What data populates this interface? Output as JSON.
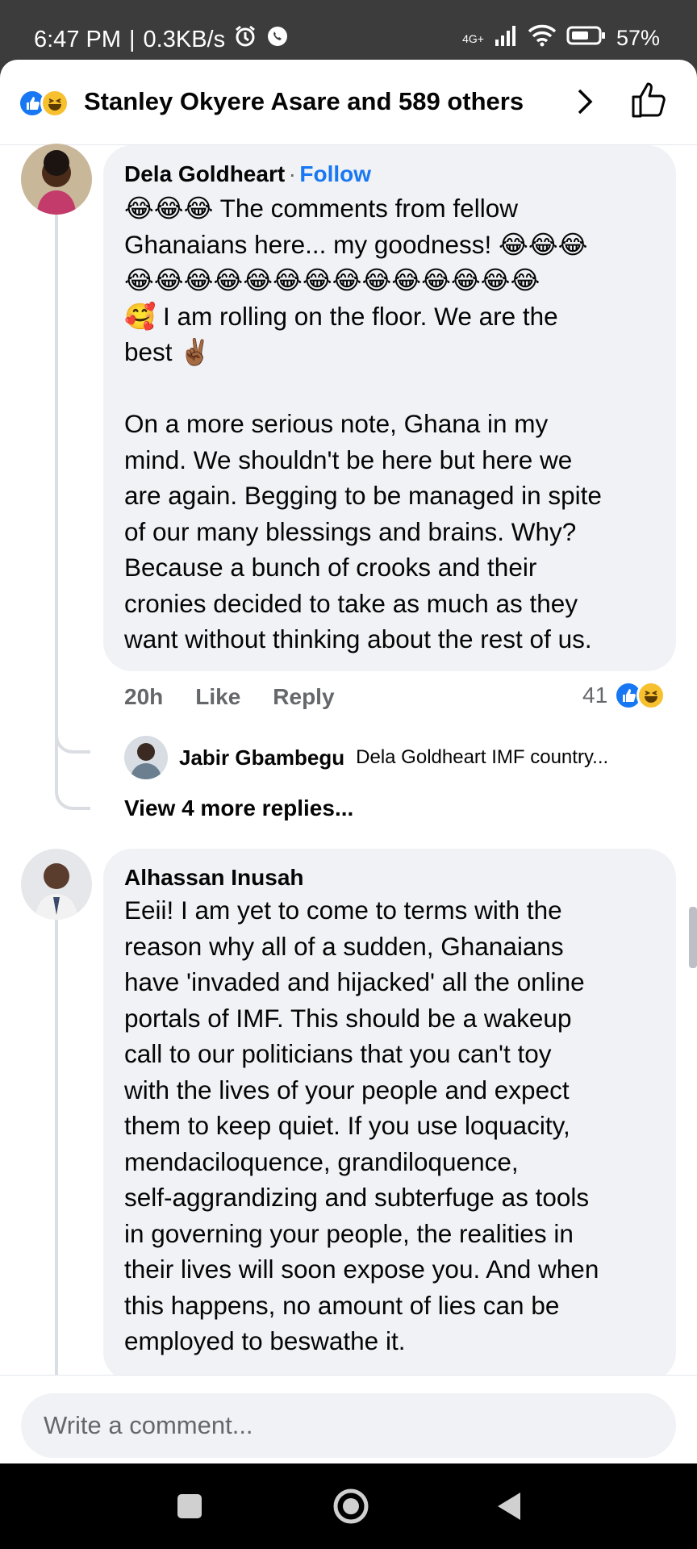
{
  "status_bar": {
    "time": "6:47 PM",
    "separator": "|",
    "speed": "0.3KB/s",
    "network": "4G+",
    "battery": "57%"
  },
  "reactions_header": {
    "text": "Stanley Okyere Asare and 589 others",
    "icons": [
      "like-reaction",
      "haha-reaction"
    ]
  },
  "comments": [
    {
      "author": "Dela Goldheart",
      "separator": "·",
      "follow_label": "Follow",
      "text": "😂😂😂 The comments from fellow\nGhanaians here... my goodness! 😂😂😂\n😂😂😂😂😂😂😂😂😂😂😂😂😂😂\n🥰 I am rolling on the floor. We are the\nbest ✌🏾\n\nOn a more serious note, Ghana in my\nmind. We shouldn't be here but here we\nare again. Begging to be managed in spite\nof our many blessings and brains. Why?\nBecause a bunch of crooks and their\ncronies decided to take as much as they\nwant without thinking about the rest of us.",
      "time": "20h",
      "like_label": "Like",
      "reply_label": "Reply",
      "reaction_count": "41",
      "reply_preview": {
        "author": "Jabir Gbambegu",
        "text": "Dela Goldheart IMF country..."
      },
      "view_more": "View 4 more replies..."
    },
    {
      "author": "Alhassan Inusah",
      "text": "Eeii! I am yet to come to terms with the\nreason why all of a sudden, Ghanaians\nhave 'invaded and hijacked' all the online\nportals of IMF. This should be a wakeup\ncall to our politicians that you can't toy\nwith the lives of your people and expect\nthem to keep quiet. If you use loquacity,\nmendaciloquence, grandiloquence,\nself-aggrandizing and subterfuge as tools\nin governing your people, the realities in\ntheir lives will soon expose you. And when\nthis happens, no amount of lies can be\nemployed to beswathe it."
    }
  ],
  "composer": {
    "placeholder": "Write a comment..."
  },
  "colors": {
    "accent": "#1877f2",
    "bubble": "#f0f2f5",
    "muted": "#65676b"
  }
}
